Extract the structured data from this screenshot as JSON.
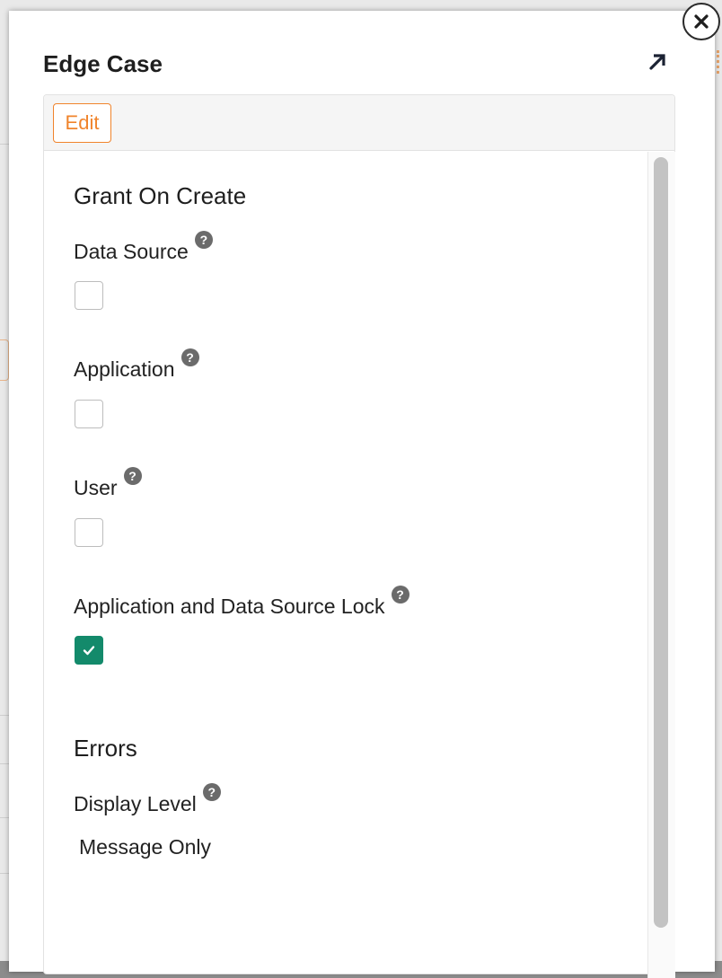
{
  "modal": {
    "title": "Edge Case",
    "edit_label": "Edit",
    "sections": {
      "grant": {
        "title": "Grant On Create",
        "fields": [
          {
            "label": "Data Source",
            "checked": false
          },
          {
            "label": "Application",
            "checked": false
          },
          {
            "label": "User",
            "checked": false
          },
          {
            "label": "Application and Data Source Lock",
            "checked": true
          }
        ]
      },
      "errors": {
        "title": "Errors",
        "display_level_label": "Display Level",
        "display_level_value": "Message Only"
      }
    },
    "help_glyph": "?"
  },
  "icons": {
    "close": "close-icon",
    "expand": "arrow-up-right-icon",
    "help": "help-circle-icon",
    "check": "check-icon"
  },
  "colors": {
    "accent_orange": "#f0842c",
    "checked_green": "#138a6b"
  }
}
